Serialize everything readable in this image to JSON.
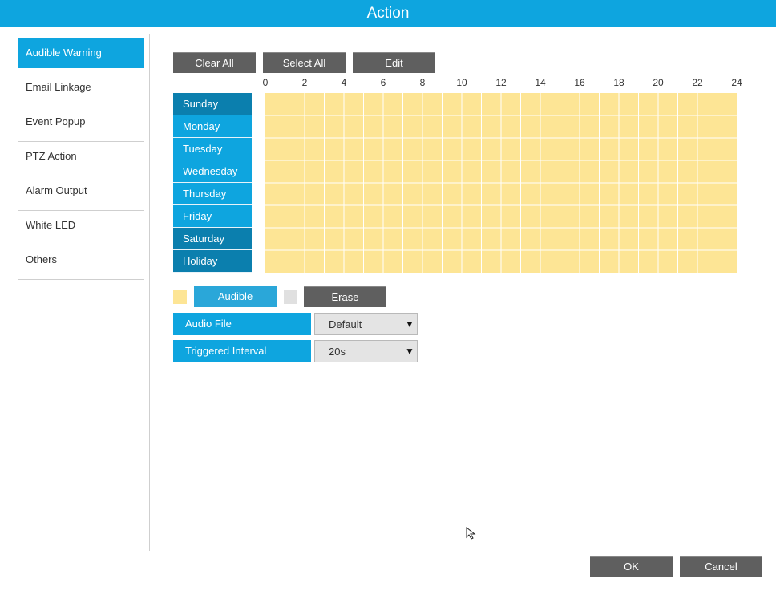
{
  "window": {
    "title": "Action"
  },
  "sidebar": {
    "items": [
      {
        "label": "Audible Warning"
      },
      {
        "label": "Email Linkage"
      },
      {
        "label": "Event Popup"
      },
      {
        "label": "PTZ Action"
      },
      {
        "label": "Alarm Output"
      },
      {
        "label": "White LED"
      },
      {
        "label": "Others"
      }
    ]
  },
  "toolbar": {
    "clear_all": "Clear All",
    "select_all": "Select All",
    "edit": "Edit"
  },
  "schedule": {
    "hour_labels": [
      "0",
      "2",
      "4",
      "6",
      "8",
      "10",
      "12",
      "14",
      "16",
      "18",
      "20",
      "22",
      "24"
    ],
    "days": [
      "Sunday",
      "Monday",
      "Tuesday",
      "Wednesday",
      "Thursday",
      "Friday",
      "Saturday",
      "Holiday"
    ],
    "fill_fraction": 1.0,
    "colors": {
      "filled": "#fde595",
      "empty": "#e0e0e0"
    }
  },
  "legend": {
    "audible_label": "Audible",
    "erase_label": "Erase"
  },
  "settings": {
    "audio_file": {
      "label": "Audio File",
      "value": "Default"
    },
    "triggered_interval": {
      "label": "Triggered Interval",
      "value": "20s"
    }
  },
  "footer": {
    "ok": "OK",
    "cancel": "Cancel"
  },
  "theme": {
    "accent": "#0ea5df",
    "accent_dark": "#0b7fae",
    "button_gray": "#5f5f5f"
  }
}
